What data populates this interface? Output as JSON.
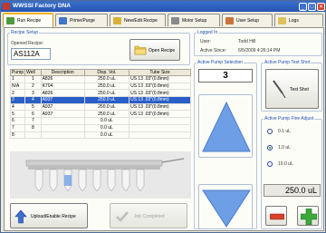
{
  "window": {
    "title": "WWSSI Factory DNA",
    "min_glyph": "_",
    "max_glyph": "□",
    "close_glyph": "✕"
  },
  "tabs": [
    {
      "label": "Run Recipe",
      "active": true
    },
    {
      "label": "Prime/Purge"
    },
    {
      "label": "New/Edit Recipe"
    },
    {
      "label": "Motor Setup"
    },
    {
      "label": "User Setup"
    },
    {
      "label": "Logs"
    }
  ],
  "recipe_setup": {
    "title": "Recipe Setup",
    "opened_label": "Opened Recipe:",
    "opened_value": "AS112A",
    "open_button": "Open Recipe"
  },
  "logged_in": {
    "title": "Logged In",
    "user_label": "User:",
    "user_value": "Todd Hill",
    "since_label": "Active Since:",
    "since_value": "6/5/2009 4:26:14 PM"
  },
  "table": {
    "headers": [
      "Pump",
      "Well",
      "Description",
      "Disp. Vol.",
      "Tube Size"
    ],
    "rows": [
      [
        "1",
        "1",
        "A826",
        "250.0 uL",
        "US 13 .03\"(0.8mm)"
      ],
      [
        "N/A",
        "2",
        "K704",
        "250.0 uL",
        "US 13 .03\"(0.8mm)"
      ],
      [
        "2",
        "3",
        "A826",
        "250.0 uL",
        "US 13 .03\"(0.8mm)"
      ],
      [
        "3",
        "4",
        "A937",
        "250.0 uL",
        "US 13 .03\"(0.8mm)"
      ],
      [
        "4",
        "5",
        "A937",
        "250.0 uL",
        "US 13 .03\"(0.8mm)"
      ],
      [
        "5",
        "6",
        "A937",
        "250.0 uL",
        "US 13 .03\"(0.8mm)"
      ],
      [
        "6",
        "7",
        "",
        "0.0 uL",
        ""
      ],
      [
        "7",
        "8",
        "",
        "0.0 uL",
        ""
      ],
      [
        "8",
        "",
        "",
        "0.0 uL",
        ""
      ]
    ],
    "selected_row": 3
  },
  "actions": {
    "upload_button": "Upload/Enable Recipe",
    "completed_button": "Job Completed"
  },
  "active_pump": {
    "title": "Active Pump Selection",
    "value": "3"
  },
  "test_shot": {
    "title": "Active Pump Test Shot",
    "button": "Test Shot"
  },
  "fine_adjust": {
    "title": "Active Pump Fine Adjust",
    "options": [
      "0.1 uL",
      "1.0 uL",
      "10.0 uL"
    ],
    "selected": "1.0 uL",
    "display_value": "250.0 uL"
  },
  "colors": {
    "selection": "#2a5ec8",
    "arrow": "#6e9fe6",
    "minus": "#d8402a",
    "plus": "#3ca83c",
    "title_blue": "#1f4fb6"
  }
}
